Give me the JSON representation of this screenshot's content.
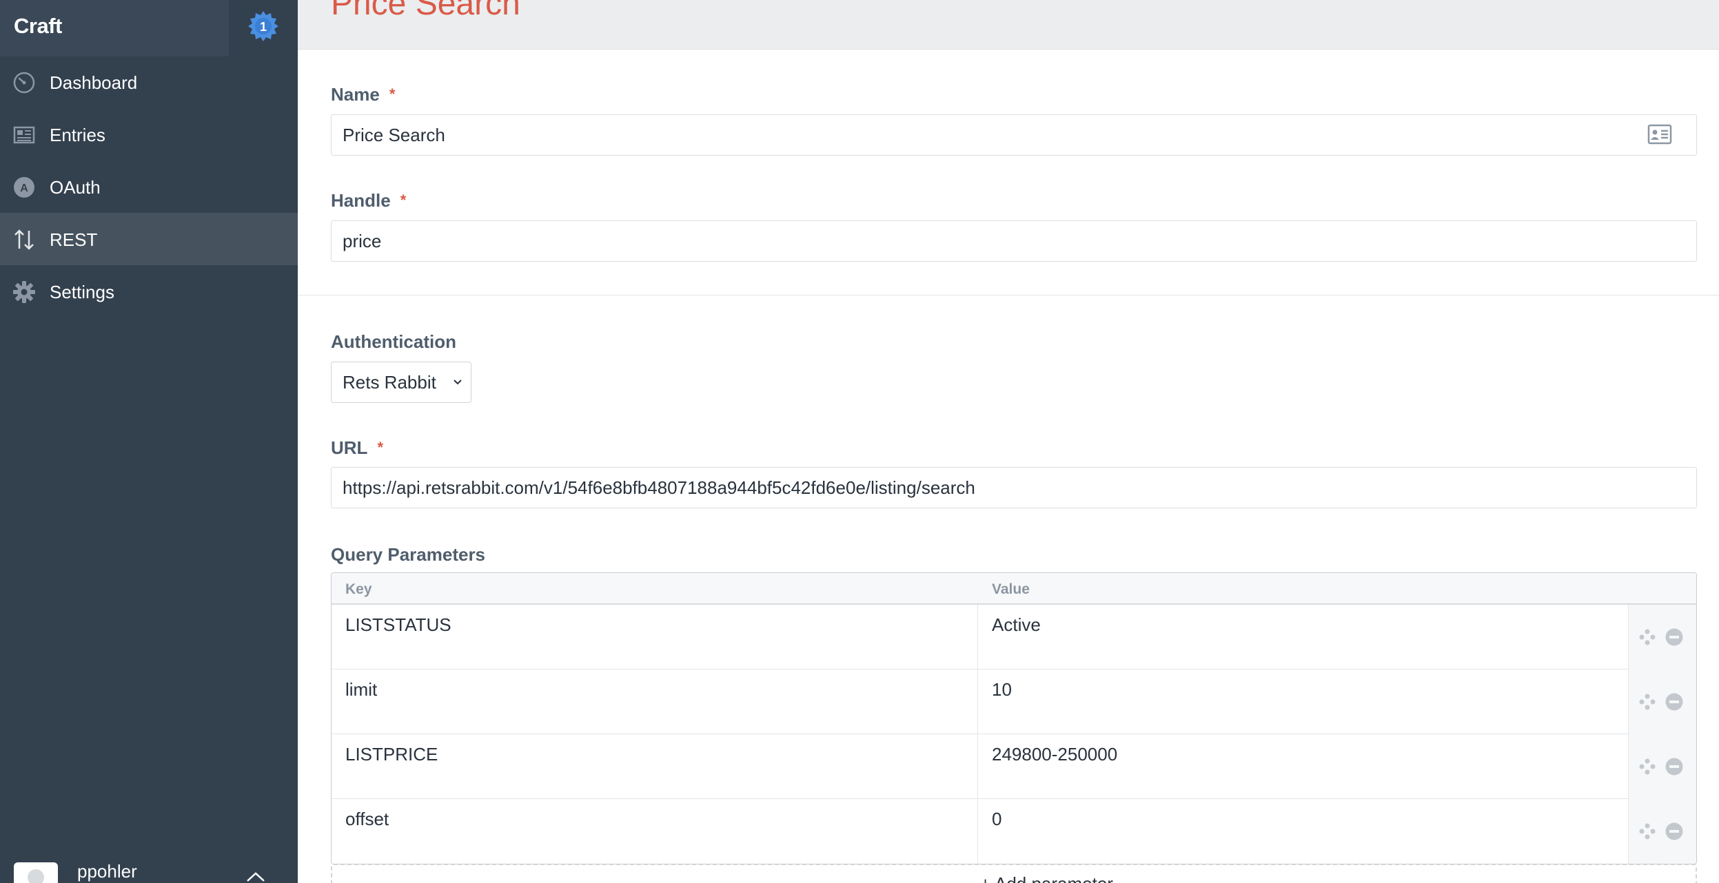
{
  "sidebar": {
    "brand": "Craft",
    "badge_count": "1",
    "items": [
      {
        "label": "Dashboard",
        "icon": "gauge-icon"
      },
      {
        "label": "Entries",
        "icon": "newspaper-icon"
      },
      {
        "label": "OAuth",
        "icon": "oauth-icon"
      },
      {
        "label": "REST",
        "icon": "arrows-updown-icon",
        "active": true
      },
      {
        "label": "Settings",
        "icon": "gear-icon"
      }
    ],
    "user": {
      "name": "ppohler"
    }
  },
  "page": {
    "title": "Price Search"
  },
  "form": {
    "name": {
      "label": "Name",
      "required_mark": "*",
      "value": "Price Search"
    },
    "handle": {
      "label": "Handle",
      "required_mark": "*",
      "value": "price"
    },
    "authentication": {
      "label": "Authentication",
      "selected": "Rets Rabbit"
    },
    "url": {
      "label": "URL",
      "required_mark": "*",
      "value": "https://api.retsrabbit.com/v1/54f6e8bfb4807188a944bf5c42fd6e0e/listing/search"
    },
    "query_params": {
      "label": "Query Parameters",
      "columns": [
        "Key",
        "Value"
      ],
      "rows": [
        {
          "key": "LISTSTATUS",
          "value": "Active"
        },
        {
          "key": "limit",
          "value": "10"
        },
        {
          "key": "LISTPRICE",
          "value": "249800-250000"
        },
        {
          "key": "offset",
          "value": "0"
        }
      ],
      "add_label": "+ Add parameter"
    }
  },
  "colors": {
    "sidebar_bg": "#33404e",
    "accent_red": "#da5a47",
    "badge_blue": "#4a90e2"
  }
}
